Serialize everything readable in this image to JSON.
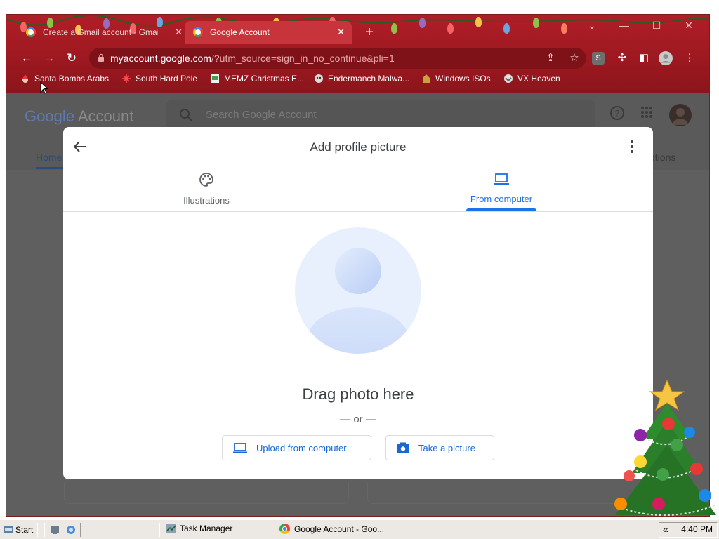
{
  "browser": {
    "tabs": [
      {
        "title": "Create a Gmail account - Gmail",
        "active": false
      },
      {
        "title": "Google Account",
        "active": true
      }
    ],
    "url_host": "myaccount.google.com",
    "url_path": "/?utm_source=sign_in_no_continue&pli=1",
    "profile_badge": "S",
    "bookmarks": [
      {
        "label": "Santa Bombs Arabs"
      },
      {
        "label": "South Hard Pole"
      },
      {
        "label": "MEMZ Christmas E..."
      },
      {
        "label": "Endermanch Malwa..."
      },
      {
        "label": "Windows ISOs"
      },
      {
        "label": "VX Heaven"
      }
    ],
    "theme_color": "#9c1820"
  },
  "page": {
    "logo_google": "Google",
    "logo_account": "Account",
    "search_placeholder": "Search Google Account",
    "home_tab": "Home",
    "options_tab": "ptions"
  },
  "dialog": {
    "title": "Add profile picture",
    "tabs": [
      {
        "label": "Illustrations",
        "active": false
      },
      {
        "label": "From computer",
        "active": true
      }
    ],
    "drag_text": "Drag photo here",
    "or_text": "— or —",
    "upload_label": "Upload from computer",
    "take_label": "Take a picture",
    "accent": "#1a73e8"
  },
  "taskbar": {
    "start_label": "Start",
    "items": [
      {
        "label": "Task Manager"
      },
      {
        "label": "Google Account - Goo..."
      }
    ],
    "clock": "4:40 PM"
  }
}
